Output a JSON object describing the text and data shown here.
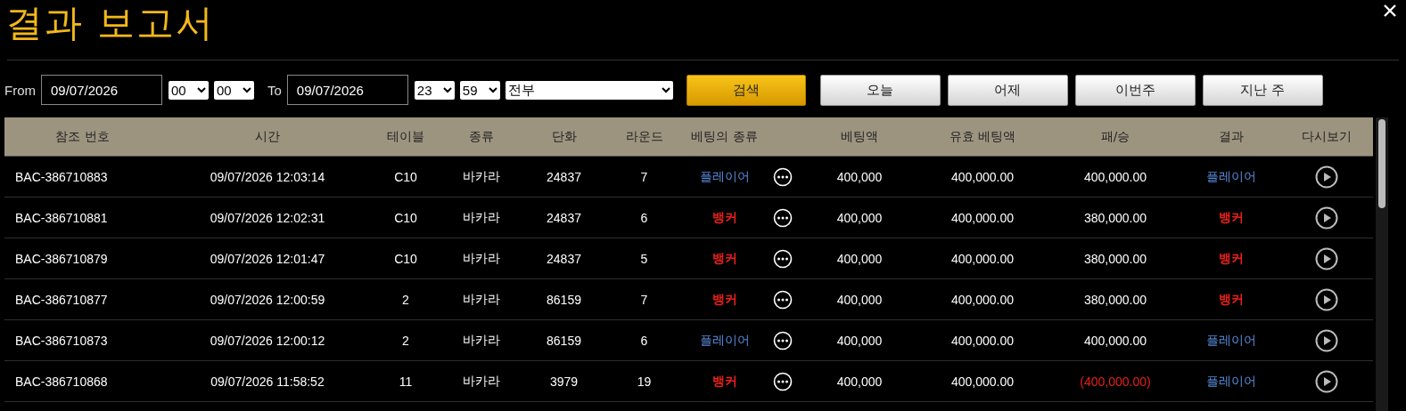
{
  "window": {
    "title": "결과 보고서"
  },
  "filter": {
    "from_label": "From",
    "from_date": "09/07/2026",
    "from_hour": "00",
    "from_minute": "00",
    "to_label": "To",
    "to_date": "09/07/2026",
    "to_hour": "23",
    "to_minute": "59",
    "game_type": "전부"
  },
  "buttons": [
    {
      "label": "검색",
      "kind": "primary"
    },
    {
      "label": "오늘",
      "kind": "default"
    },
    {
      "label": "어제",
      "kind": "default"
    },
    {
      "label": "이번주",
      "kind": "default"
    },
    {
      "label": "지난 주",
      "kind": "default"
    }
  ],
  "table": {
    "columns": [
      "참조 번호",
      "시간",
      "테이블",
      "종류",
      "단화",
      "라운드",
      "베팅의 종류",
      "베팅액",
      "유효 베팅액",
      "패/승",
      "결과",
      "다시보기"
    ],
    "rows": [
      {
        "ref": "BAC-386710883",
        "time": "09/07/2026 12:03:14",
        "table": "C10",
        "game": "바카라",
        "shoe": "24837",
        "round": "7",
        "bet_type": {
          "label": "플레이어",
          "kind": "player"
        },
        "bet": "400,000",
        "valid_bet": "400,000.00",
        "win_loss": {
          "text": "400,000.00",
          "negative": false
        },
        "result": {
          "label": "플레이어",
          "kind": "player"
        }
      },
      {
        "ref": "BAC-386710881",
        "time": "09/07/2026 12:02:31",
        "table": "C10",
        "game": "바카라",
        "shoe": "24837",
        "round": "6",
        "bet_type": {
          "label": "뱅커",
          "kind": "banker"
        },
        "bet": "400,000",
        "valid_bet": "400,000.00",
        "win_loss": {
          "text": "380,000.00",
          "negative": false
        },
        "result": {
          "label": "뱅커",
          "kind": "banker"
        }
      },
      {
        "ref": "BAC-386710879",
        "time": "09/07/2026 12:01:47",
        "table": "C10",
        "game": "바카라",
        "shoe": "24837",
        "round": "5",
        "bet_type": {
          "label": "뱅커",
          "kind": "banker"
        },
        "bet": "400,000",
        "valid_bet": "400,000.00",
        "win_loss": {
          "text": "380,000.00",
          "negative": false
        },
        "result": {
          "label": "뱅커",
          "kind": "banker"
        }
      },
      {
        "ref": "BAC-386710877",
        "time": "09/07/2026 12:00:59",
        "table": "2",
        "game": "바카라",
        "shoe": "86159",
        "round": "7",
        "bet_type": {
          "label": "뱅커",
          "kind": "banker"
        },
        "bet": "400,000",
        "valid_bet": "400,000.00",
        "win_loss": {
          "text": "380,000.00",
          "negative": false
        },
        "result": {
          "label": "뱅커",
          "kind": "banker"
        }
      },
      {
        "ref": "BAC-386710873",
        "time": "09/07/2026 12:00:12",
        "table": "2",
        "game": "바카라",
        "shoe": "86159",
        "round": "6",
        "bet_type": {
          "label": "플레이어",
          "kind": "player"
        },
        "bet": "400,000",
        "valid_bet": "400,000.00",
        "win_loss": {
          "text": "400,000.00",
          "negative": false
        },
        "result": {
          "label": "플레이어",
          "kind": "player"
        }
      },
      {
        "ref": "BAC-386710868",
        "time": "09/07/2026 11:58:52",
        "table": "11",
        "game": "바카라",
        "shoe": "3979",
        "round": "19",
        "bet_type": {
          "label": "뱅커",
          "kind": "banker"
        },
        "bet": "400,000",
        "valid_bet": "400,000.00",
        "win_loss": {
          "text": "(400,000.00)",
          "negative": true
        },
        "result": {
          "label": "플레이어",
          "kind": "player"
        }
      }
    ]
  }
}
